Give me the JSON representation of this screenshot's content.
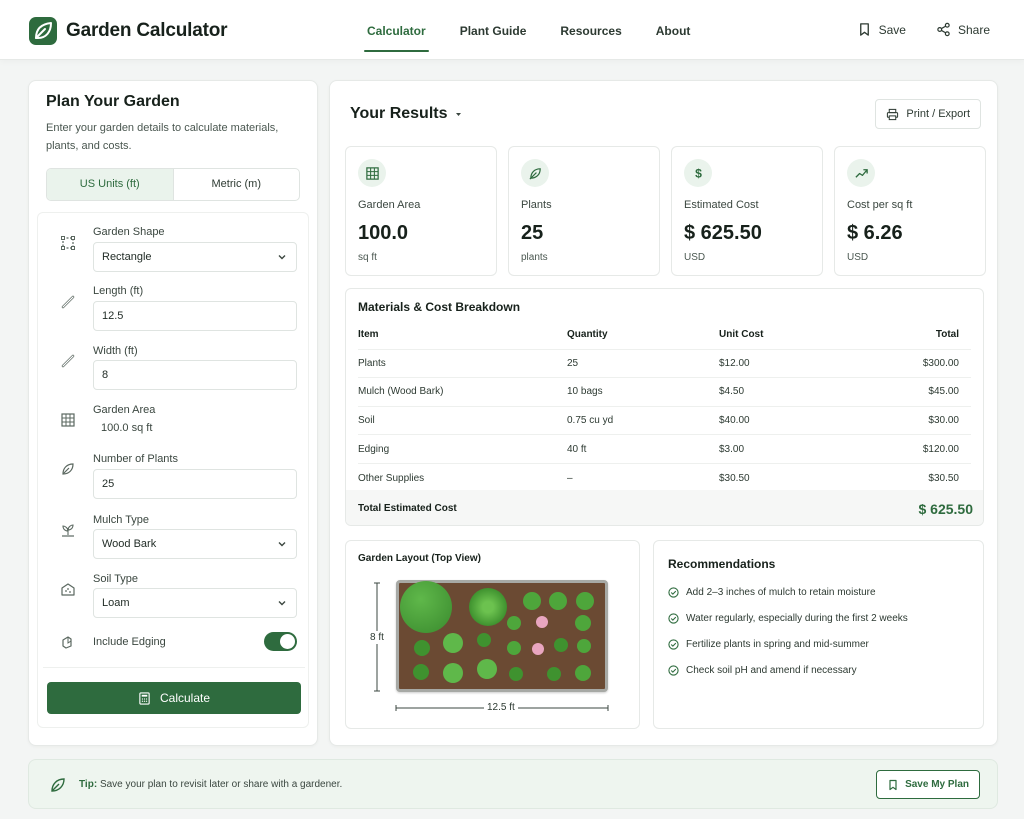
{
  "app": {
    "name": "Garden Calculator",
    "logo_icon": "leaf-icon",
    "accent": "#2e6b3e"
  },
  "nav": {
    "items": [
      {
        "label": "Calculator",
        "active": true
      },
      {
        "label": "Plant Guide",
        "active": false
      },
      {
        "label": "Resources",
        "active": false
      },
      {
        "label": "About",
        "active": false
      }
    ]
  },
  "header_actions": {
    "save": "Save",
    "share": "Share"
  },
  "plan": {
    "title": "Plan Your Garden",
    "description": "Enter your garden details to calculate materials, plants, and costs.",
    "units": [
      {
        "label": "US Units (ft)",
        "active": true
      },
      {
        "label": "Metric (m)",
        "active": false
      }
    ],
    "fields": {
      "shape": {
        "label": "Garden Shape",
        "value": "Rectangle"
      },
      "length": {
        "label": "Length (ft)",
        "value": "12.5"
      },
      "width": {
        "label": "Width (ft)",
        "value": "8"
      },
      "area": {
        "label": "Garden Area",
        "value": "100.0 sq ft"
      },
      "plants": {
        "label": "Number of Plants",
        "value": "25"
      },
      "mulch": {
        "label": "Mulch Type",
        "value": "Wood Bark"
      },
      "soil": {
        "label": "Soil Type",
        "value": "Loam"
      },
      "edging": {
        "label": "Include Edging",
        "enabled": true
      }
    },
    "calculate_label": "Calculate"
  },
  "results": {
    "title": "Your Results",
    "print_label": "Print / Export",
    "stats": [
      {
        "label": "Garden Area",
        "value": "100.0",
        "unit": "sq ft",
        "icon": "grid-icon"
      },
      {
        "label": "Plants",
        "value": "25",
        "unit": "plants",
        "icon": "sprout-icon"
      },
      {
        "label": "Estimated Cost",
        "value": "$ 625.50",
        "unit": "USD",
        "icon": "dollar-icon"
      },
      {
        "label": "Cost per sq ft",
        "value": "$ 6.26",
        "unit": "USD",
        "icon": "trend-up-icon"
      }
    ],
    "breakdown": {
      "title": "Materials & Cost Breakdown",
      "columns": [
        "Item",
        "Quantity",
        "Unit Cost",
        "Total"
      ],
      "rows": [
        [
          "Plants",
          "25",
          "$12.00",
          "$300.00"
        ],
        [
          "Mulch (Wood Bark)",
          "10 bags",
          "$4.50",
          "$45.00"
        ],
        [
          "Soil",
          "0.75 cu yd",
          "$40.00",
          "$30.00"
        ],
        [
          "Edging",
          "40 ft",
          "$3.00",
          "$120.00"
        ],
        [
          "Other Supplies",
          "–",
          "$30.50",
          "$30.50"
        ]
      ],
      "total_label": "Total Estimated Cost",
      "total_value": "$ 625.50"
    },
    "layout": {
      "title": "Garden Layout (Top View)",
      "height_label": "8 ft",
      "width_label": "12.5 ft"
    },
    "recommendations": {
      "title": "Recommendations",
      "items": [
        "Add 2–3 inches of mulch to retain moisture",
        "Water regularly, especially during the first 2 weeks",
        "Fertilize plants in spring and mid-summer",
        "Check soil pH and amend if necessary"
      ]
    }
  },
  "tip": {
    "label": "Tip:",
    "text": "Save your plan to revisit later or share with a gardener.",
    "button": "Save My Plan"
  }
}
